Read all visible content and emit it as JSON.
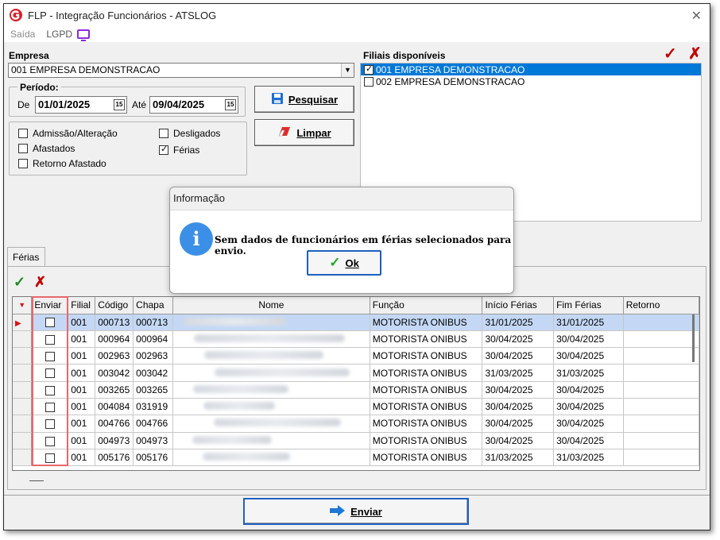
{
  "window": {
    "title": "FLP - Integração Funcionários - ATSLOG"
  },
  "menu": {
    "items": [
      "Saída",
      "LGPD"
    ]
  },
  "empresa": {
    "label": "Empresa",
    "value": "001 EMPRESA DEMONSTRACAO"
  },
  "periodo": {
    "label": "Período:",
    "de_label": "De",
    "de_value": "01/01/2025",
    "ate_label": "Até",
    "ate_value": "09/04/2025"
  },
  "buttons": {
    "pesquisar": "Pesquisar",
    "limpar": "Limpar",
    "enviar": "Enviar"
  },
  "filters": [
    {
      "label": "Admissão/Alteração",
      "checked": false
    },
    {
      "label": "Afastados",
      "checked": false
    },
    {
      "label": "Retorno Afastado",
      "checked": false
    },
    {
      "label": "Desligados",
      "checked": false
    },
    {
      "label": "Férias",
      "checked": true
    }
  ],
  "filiais": {
    "label": "Filiais disponíveis",
    "items": [
      {
        "label": "001 EMPRESA DEMONSTRACAO",
        "checked": true,
        "selected": true
      },
      {
        "label": "002 EMPRESA DEMONSTRACAO",
        "checked": false,
        "selected": false
      }
    ]
  },
  "tab": {
    "label": "Férias"
  },
  "grid": {
    "columns": [
      "Enviar",
      "Filial",
      "Código",
      "Chapa",
      "Nome",
      "Função",
      "Início Férias",
      "Fim Férias",
      "Retorno"
    ],
    "rows": [
      {
        "filial": "001",
        "codigo": "000713",
        "chapa": "000713",
        "funcao": "MOTORISTA ONIBUS",
        "inicio": "31/01/2025",
        "fim": "31/01/2025",
        "retorno": ""
      },
      {
        "filial": "001",
        "codigo": "000964",
        "chapa": "000964",
        "funcao": "MOTORISTA ONIBUS",
        "inicio": "30/04/2025",
        "fim": "30/04/2025",
        "retorno": ""
      },
      {
        "filial": "001",
        "codigo": "002963",
        "chapa": "002963",
        "funcao": "MOTORISTA ONIBUS",
        "inicio": "30/04/2025",
        "fim": "30/04/2025",
        "retorno": ""
      },
      {
        "filial": "001",
        "codigo": "003042",
        "chapa": "003042",
        "funcao": "MOTORISTA ONIBUS",
        "inicio": "31/03/2025",
        "fim": "31/03/2025",
        "retorno": ""
      },
      {
        "filial": "001",
        "codigo": "003265",
        "chapa": "003265",
        "funcao": "MOTORISTA ONIBUS",
        "inicio": "30/04/2025",
        "fim": "30/04/2025",
        "retorno": ""
      },
      {
        "filial": "001",
        "codigo": "004084",
        "chapa": "031919",
        "funcao": "MOTORISTA ONIBUS",
        "inicio": "30/04/2025",
        "fim": "30/04/2025",
        "retorno": ""
      },
      {
        "filial": "001",
        "codigo": "004766",
        "chapa": "004766",
        "funcao": "MOTORISTA ONIBUS",
        "inicio": "30/04/2025",
        "fim": "30/04/2025",
        "retorno": ""
      },
      {
        "filial": "001",
        "codigo": "004973",
        "chapa": "004973",
        "funcao": "MOTORISTA ONIBUS",
        "inicio": "30/04/2025",
        "fim": "30/04/2025",
        "retorno": ""
      },
      {
        "filial": "001",
        "codigo": "005176",
        "chapa": "005176",
        "funcao": "MOTORISTA ONIBUS",
        "inicio": "31/03/2025",
        "fim": "31/03/2025",
        "retorno": ""
      }
    ]
  },
  "dialog": {
    "title": "Informação",
    "icon": "info-icon",
    "message": "Sem dados de funcionários em férias selecionados para envio.",
    "ok_label": "Ok"
  },
  "colors": {
    "accent": "#0078d7",
    "highlight_box": "#e8676b",
    "check": "#1f8a1f",
    "cross": "#c00000"
  }
}
